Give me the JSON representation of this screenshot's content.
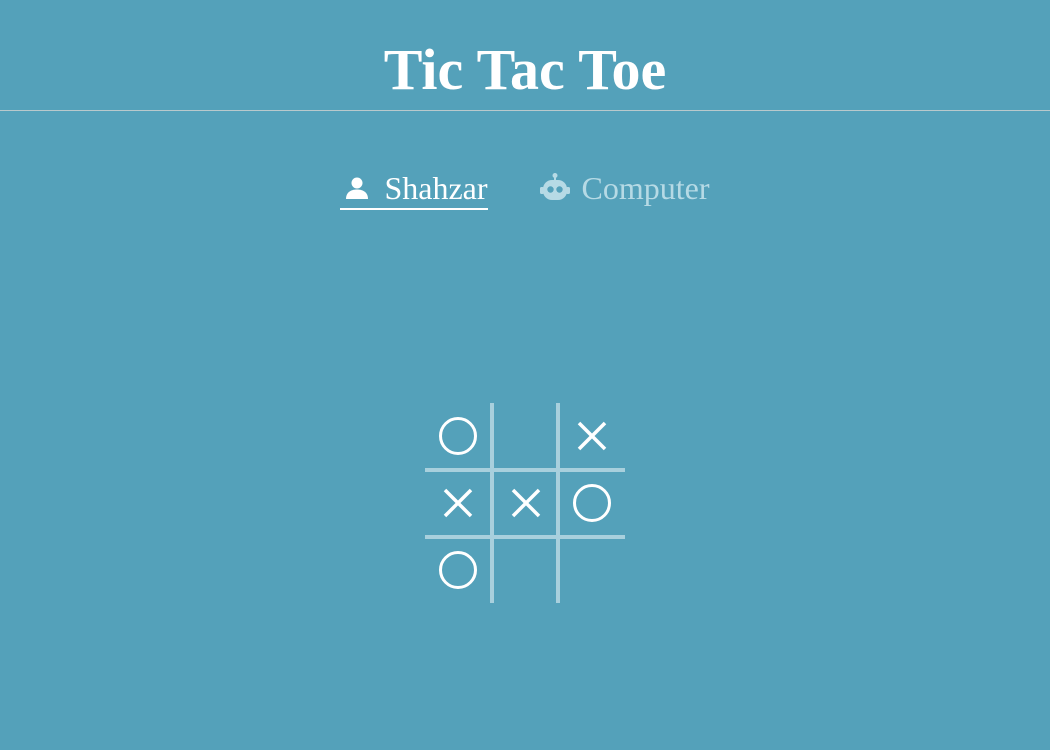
{
  "header": {
    "title": "Tic Tac Toe"
  },
  "players": [
    {
      "name": "Shahzar",
      "icon": "person-icon",
      "active": true
    },
    {
      "name": "Computer",
      "icon": "robot-icon",
      "active": false
    }
  ],
  "board": {
    "cells": [
      "O",
      "",
      "X",
      "X",
      "X",
      "O",
      "O",
      "",
      ""
    ]
  },
  "colors": {
    "background": "#54a1ba",
    "text": "#ffffff",
    "inactive_text": "#b6dae5",
    "grid_lines": "#a8d0dd",
    "header_rule": "#b9c9cc"
  }
}
